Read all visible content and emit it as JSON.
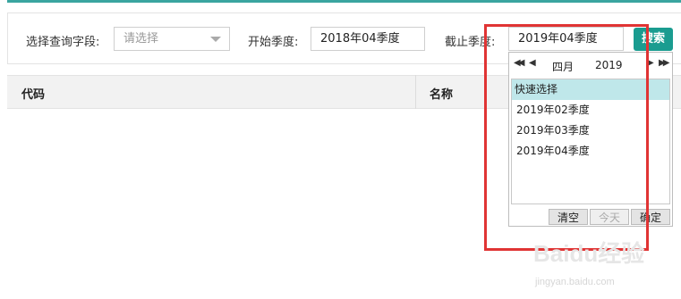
{
  "filters": {
    "field_label": "选择查询字段:",
    "field_placeholder": "请选择",
    "start_label": "开始季度:",
    "start_value": "2018年04季度",
    "end_label": "截止季度:",
    "end_value": "2019年04季度",
    "search_label": "搜索"
  },
  "table": {
    "columns": [
      "代码",
      "名称"
    ]
  },
  "datepicker": {
    "nav_prev_year": "◀◀",
    "nav_prev_month": "◀",
    "nav_next_month": "▶",
    "nav_next_year": "▶▶",
    "month": "四月",
    "year": "2019",
    "quick_select_label": "快速选择",
    "quick_options": [
      "2019年02季度",
      "2019年03季度",
      "2019年04季度"
    ],
    "clear_label": "清空",
    "today_label": "今天",
    "confirm_label": "确定"
  },
  "watermark": {
    "logo_text": "Baidu经验",
    "url": "jingyan.baidu.com"
  },
  "colors": {
    "accent": "#1a9c90",
    "highlight": "#e03434",
    "quick_select_bg": "#bfe7ea"
  }
}
